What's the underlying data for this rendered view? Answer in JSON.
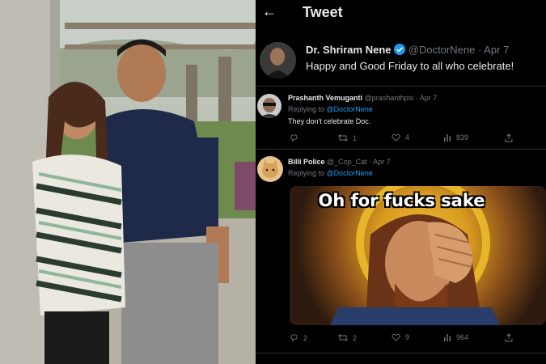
{
  "photo": {
    "icon": "couple-photo"
  },
  "header": {
    "back_icon": "←",
    "title": "Tweet"
  },
  "main_tweet": {
    "name": "Dr. Shriram Nene",
    "handle": "@DoctorNene",
    "date": "· Apr 7",
    "text": "Happy and Good Friday to all who celebrate!",
    "verified_color": "#1d9bf0"
  },
  "replies": [
    {
      "name": "Prashanth Vemuganti",
      "handle": "@prashanthpsi",
      "date": "· Apr 7",
      "replying_prefix": "Replying to",
      "replying_to": "@DoctorNene",
      "text": "They don't celebrate Doc.",
      "actions": {
        "reply": "",
        "retweet": "1",
        "like": "4",
        "views": "839"
      }
    },
    {
      "name": "Billi Police",
      "handle": "@_Cop_Cat",
      "date": "· Apr 7",
      "replying_prefix": "Replying to",
      "replying_to": "@DoctorNene",
      "meme_caption": "Oh for fucks sake",
      "actions": {
        "reply": "2",
        "retweet": "2",
        "like": "9",
        "views": "964"
      }
    }
  ],
  "colors": {
    "background": "#000000",
    "text": "#e7e9ea",
    "muted": "#71767b",
    "link": "#1d9bf0"
  }
}
